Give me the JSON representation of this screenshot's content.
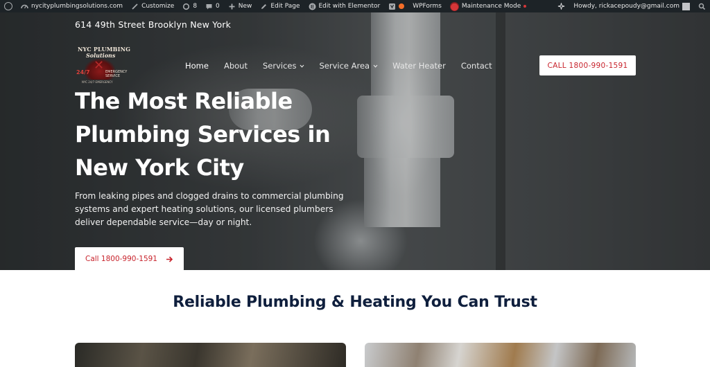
{
  "admin_bar": {
    "site": "nycityplumbingsolutions.com",
    "customize": "Customize",
    "updates_count": "8",
    "comments_count": "0",
    "new": "New",
    "edit_page": "Edit Page",
    "edit_elementor": "Edit with Elementor",
    "wpforms": "WPForms",
    "maintenance": "Maintenance Mode",
    "howdy": "Howdy, rickacepoudy@gmail.com"
  },
  "header": {
    "address": "614 49th Street Brooklyn New York",
    "logo": {
      "line1": "NYC PLUMBING",
      "line2": "Solutions",
      "line3": "24/7",
      "line4": "EMERGENCY SERVICE",
      "line5": "NYC 24/7 EMERGENCY"
    },
    "nav": [
      {
        "label": "Home"
      },
      {
        "label": "About"
      },
      {
        "label": "Services"
      },
      {
        "label": "Service Area"
      },
      {
        "label": "Water Heater"
      },
      {
        "label": "Contact"
      }
    ],
    "cta": "CALL 1800-990-1591"
  },
  "hero": {
    "title": "The Most Reliable Plumbing Services in New York City",
    "description": "From leaking pipes and clogged drains to commercial plumbing systems and expert heating solutions, our licensed plumbers deliver dependable service—day or night.",
    "cta": "Call 1800-990-1591"
  },
  "section": {
    "title": "Reliable Plumbing & Heating You Can Trust"
  },
  "colors": {
    "admin_bar": "#1d2327",
    "accent_red": "#c8232c",
    "heading_navy": "#0f1f3d"
  }
}
